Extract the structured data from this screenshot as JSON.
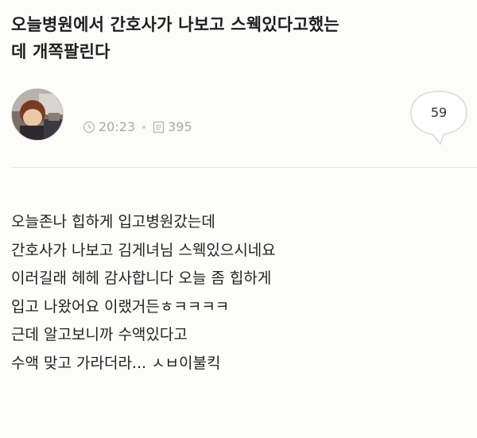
{
  "post": {
    "title_lines": [
      "오늘병원에서 간호사가 나보고 스웩있다고했는",
      "데 개쪽팔린다"
    ],
    "time": "20:23",
    "views": "395",
    "comment_count": "59",
    "body_lines": [
      "오늘존나 힙하게 입고병원갔는데",
      "간호사가 나보고 김게녀님 스웩있으시네요",
      "이러길래 헤헤 감사합니다 오늘 좀 힙하게",
      "입고 나왔어요 이랬거든ㅎㅋㅋㅋㅋ",
      "근데 알고보니까 수액있다고",
      "수액 맞고 가라더라... ㅅㅂ이불킥"
    ]
  },
  "icons": {
    "time": "clock-icon",
    "views": "document-icon",
    "comments": "comment-bubble-icon",
    "author": "avatar"
  }
}
